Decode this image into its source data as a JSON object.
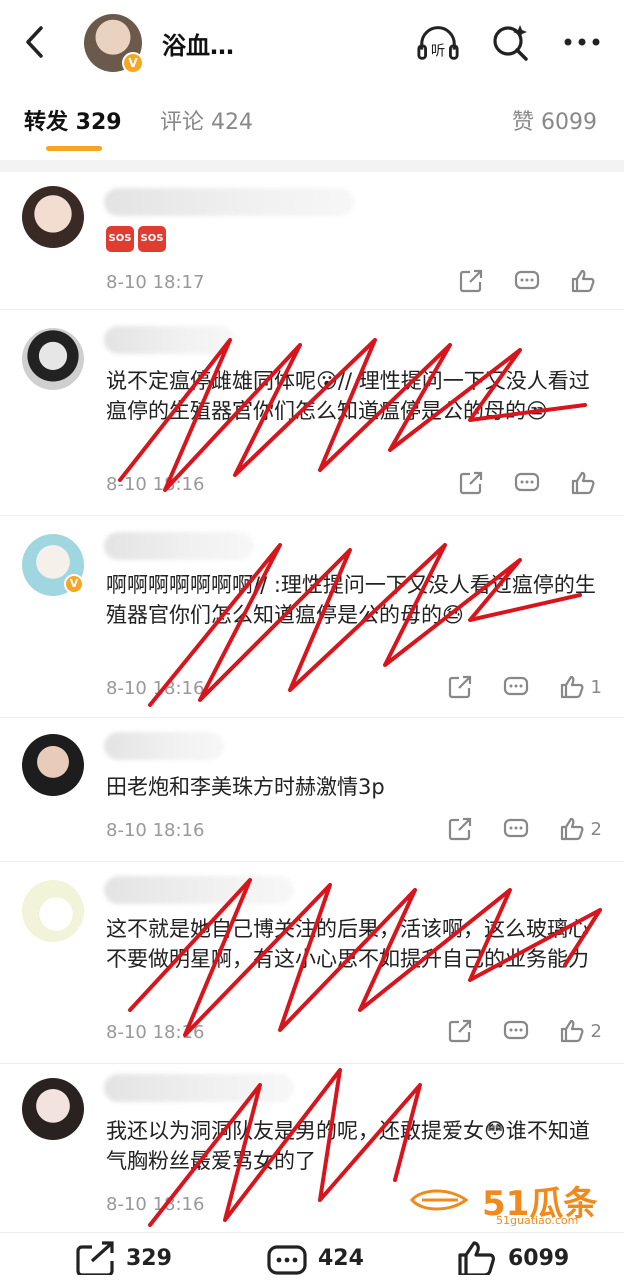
{
  "header": {
    "title": "浴血…",
    "badge": "V",
    "back_icon": "chevron-left-icon",
    "listen_label": "听",
    "listen_icon": "headphones-icon",
    "search_icon": "search-sparkle-icon",
    "more_icon": "more-icon"
  },
  "tabs": [
    {
      "label": "转发 329",
      "active": true
    },
    {
      "label": "评论 424",
      "active": false
    },
    {
      "label": "赞 6099",
      "active": false
    }
  ],
  "comments": [
    {
      "text": "",
      "has_sos": true,
      "sos_label": "SOS",
      "time": "8-10 18:17",
      "likes": "",
      "verified": false
    },
    {
      "text": "说不定瘟停雌雄同体呢😮//                理性提问一下又没人看过瘟停的生殖器官你们怎么知道瘟停是公的母的😒",
      "has_sos": false,
      "time": "8-10 18:16",
      "likes": "",
      "verified": false
    },
    {
      "text": "啊啊啊啊啊啊啊//                  :理性提问一下又没人看过瘟停的生殖器官你们怎么知道瘟停是公的母的😓",
      "has_sos": false,
      "time": "8-10 18:16",
      "likes": "1",
      "verified": true
    },
    {
      "text": "田老炮和李美珠方时赫激情3p",
      "has_sos": false,
      "time": "8-10 18:16",
      "likes": "2",
      "verified": false
    },
    {
      "text": "这不就是她自己博关注的后果，活该啊，这么玻璃心不要做明星啊，有这小心思不如提升自己的业务能力",
      "has_sos": false,
      "time": "8-10 18:16",
      "likes": "2",
      "verified": false
    },
    {
      "text": "我还以为洞洞队友是男的呢，还敢提爱女😳谁不知道气胸粉丝最爱骂女的了",
      "has_sos": false,
      "time": "8-10 18:16",
      "likes": "",
      "verified": false
    }
  ],
  "bottom": {
    "repost_count": "329",
    "comment_count": "424",
    "like_count": "6099"
  },
  "watermark": {
    "big": "51瓜条",
    "small": "51guatiao.com"
  },
  "colors": {
    "accent": "#f5a623",
    "scribble": "#d8141c",
    "sos": "#e03c31",
    "watermark": "#f08a1c"
  }
}
